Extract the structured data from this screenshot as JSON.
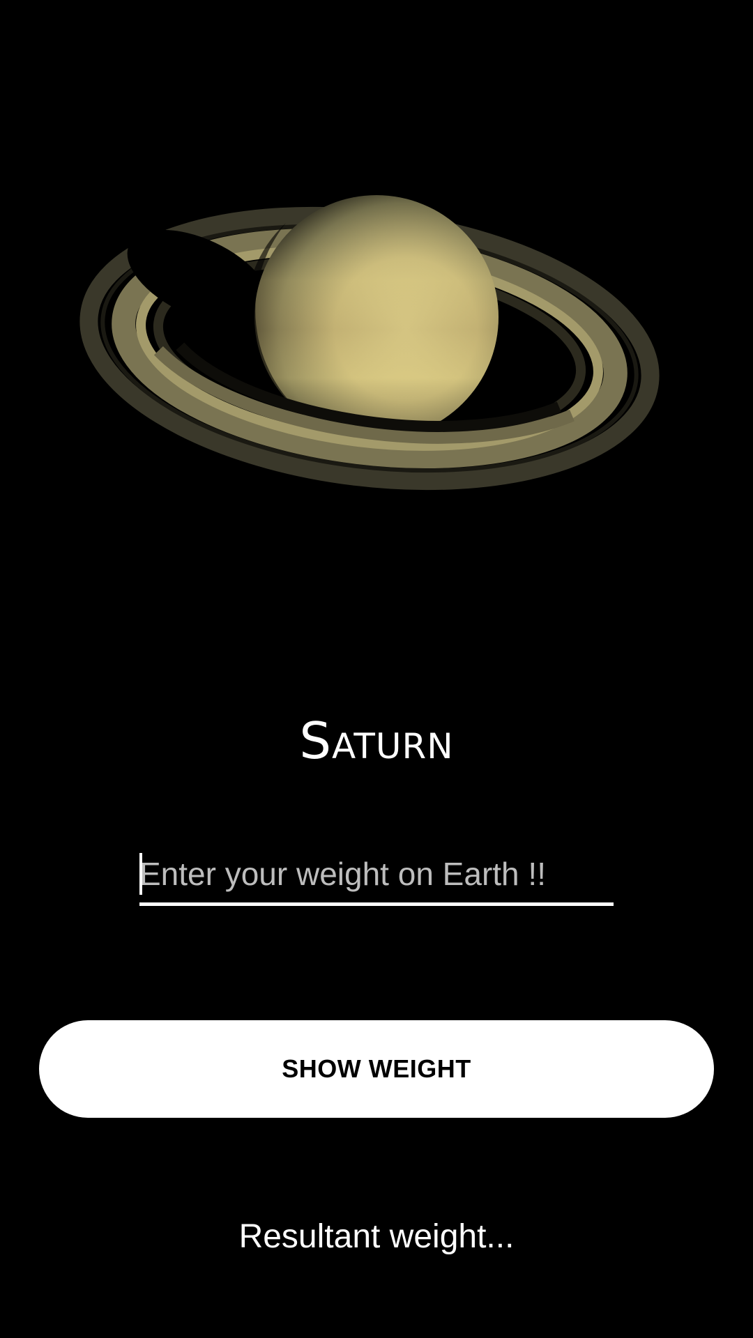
{
  "planet": {
    "name": "Saturn",
    "image_icon": "saturn-image"
  },
  "weight_input": {
    "value": "",
    "placeholder": "Enter your weight on Earth !!"
  },
  "show_button": {
    "label": "SHOW WEIGHT"
  },
  "result": {
    "text": "Resultant weight..."
  },
  "colors": {
    "background": "#000000",
    "text": "#ffffff",
    "placeholder": "#bdbdbd",
    "button_bg": "#ffffff",
    "button_text": "#000000"
  }
}
